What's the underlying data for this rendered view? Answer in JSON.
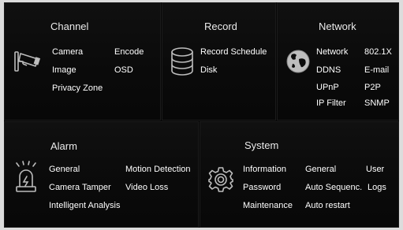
{
  "panels": {
    "channel": {
      "title": "Channel",
      "items": [
        "Camera",
        "Encode",
        "Image",
        "OSD",
        "Privacy Zone"
      ]
    },
    "record": {
      "title": "Record",
      "items": [
        "Record Schedule",
        "Disk"
      ]
    },
    "network": {
      "title": "Network",
      "items": [
        "Network",
        "802.1X",
        "DDNS",
        "E-mail",
        "UPnP",
        "P2P",
        "IP Filter",
        "SNMP"
      ]
    },
    "alarm": {
      "title": "Alarm",
      "items": [
        "General",
        "Motion Detection",
        "Camera Tamper",
        "Video Loss",
        "Intelligent Analysis"
      ]
    },
    "system": {
      "title": "System",
      "items": [
        "Information",
        "General",
        "User",
        "Password",
        "Auto Sequenc.",
        "Logs",
        "Maintenance",
        "Auto restart"
      ]
    }
  },
  "icons": {
    "channel": "cctv-camera-icon",
    "record": "database-icon",
    "network": "globe-icon",
    "alarm": "alarm-light-icon",
    "system": "gear-icon"
  },
  "colors": {
    "panel_bg": "#0b0b0b",
    "text": "#ffffff",
    "icon": "#bdbdbd",
    "frame_bg": "#dcdcdc"
  }
}
